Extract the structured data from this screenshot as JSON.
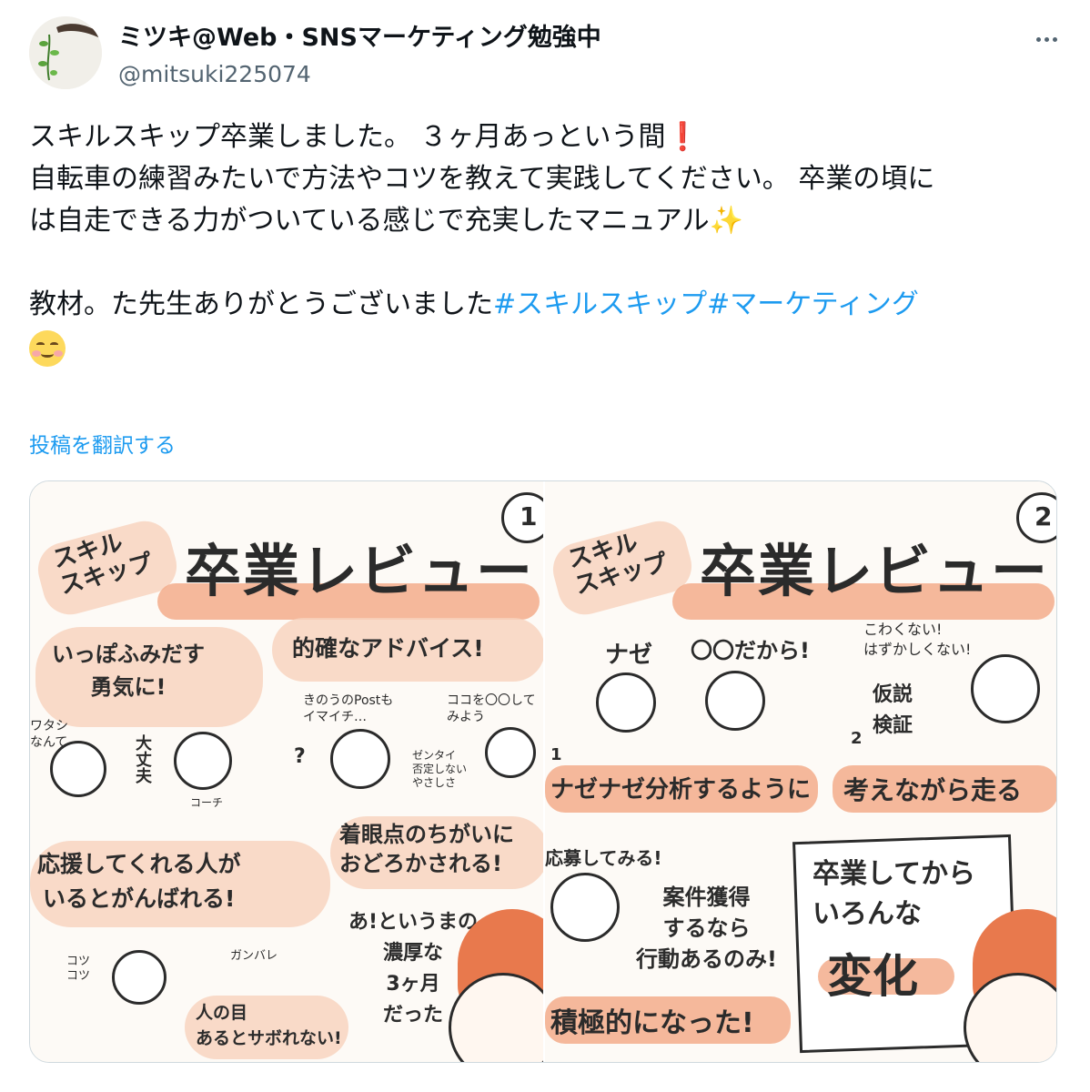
{
  "user": {
    "display_name": "ミツキ@Web・SNSマーケティング勉強中",
    "handle": "@mitsuki225074"
  },
  "tweet": {
    "line1": "スキルスキップ卒業しました。 ３ヶ月あっという間",
    "line1_emoji": "❗",
    "line2": "自転車の練習みたいで方法やコツを教えて実践してください。 卒業の頃に",
    "line3": "は自走できる力がついている感じで充実したマニュアル",
    "line3_emoji": "✨",
    "line4": "教材。た先生ありがとうございました",
    "hashtag1": "#スキルスキップ",
    "hashtag2": "#マーケティング"
  },
  "translate_label": "投稿を翻訳する",
  "media": {
    "left": {
      "badge": "スキル\nスキップ",
      "page_num": "1",
      "title": "卒業レビュー",
      "bubble1": "いっぽふみだす\n勇気に!",
      "bubble2": "的確なアドバイス!",
      "wa_tashi": "ワタシ\nなんて…",
      "daijoubu": "大丈夫",
      "coach1": "コーチ",
      "kinou": "きのうのPostも\nイマイチ…",
      "kokowo": "ココを〇〇して\nみよう",
      "zentai": "ゼンタイ\n否定しない\nやさしさ",
      "question": "?",
      "chakugan": "着眼点のちがいに\nおどろかされる!",
      "ouen": "応援してくれる人が\nいるとがんばれる!",
      "kotsu": "コツ\nコツ",
      "ganbare": "ガンバレ",
      "hitono": "人の目\nあるとサボれない!",
      "atoiuma": "あ!というまの\n濃厚な\n3ヶ月\nだった"
    },
    "right": {
      "badge": "スキル\nスキップ",
      "page_num": "2",
      "title": "卒業レビュー",
      "nazeText": "ナゼ",
      "dakara": "〇〇だから!",
      "kowaku": "こわくない!\nはずかしくない!",
      "kasetsu": "仮説\n検証",
      "num1": "1",
      "num2": "2",
      "nazenaze": "ナゼナゼ分析するように",
      "kangaenagara": "考えながら走る",
      "oubo": "応募してみる!",
      "anken": "案件獲得\nするなら\n行動あるのみ!",
      "sekkyoku": "積極的になった!",
      "sotsugyou": "卒業してから\nいろんな",
      "henka": "変化"
    }
  }
}
